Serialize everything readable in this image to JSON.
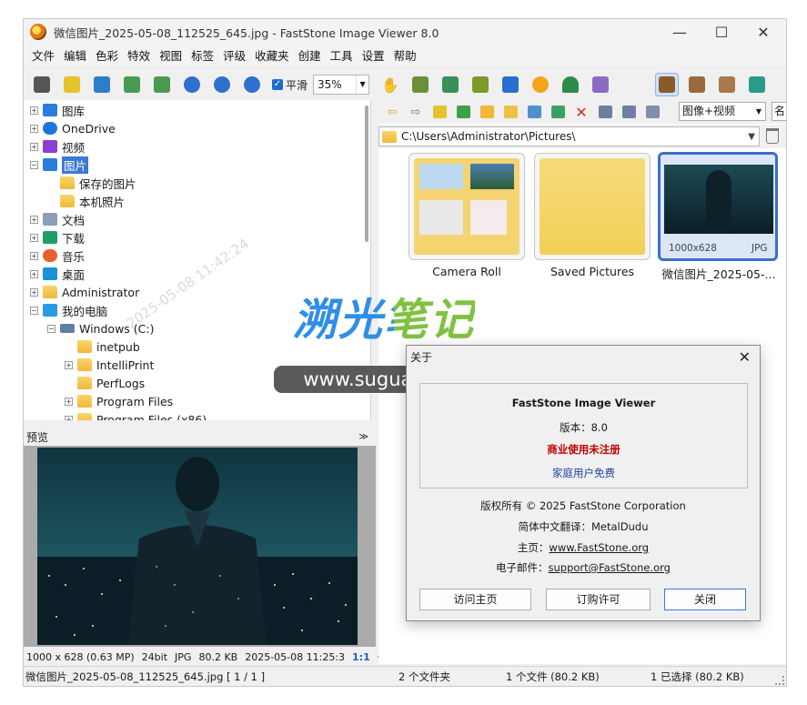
{
  "window": {
    "title": "微信图片_2025-05-08_112525_645.jpg  -  FastStone Image Viewer 8.0",
    "controls": {
      "minimize": "—",
      "maximize": "☐",
      "close": "✕"
    }
  },
  "menu": [
    "文件",
    "编辑",
    "色彩",
    "特效",
    "视图",
    "标签",
    "评级",
    "收藏夹",
    "创建",
    "工具",
    "设置",
    "帮助"
  ],
  "toolbar": {
    "smooth_label": "平滑",
    "zoom_value": "35%"
  },
  "tree": {
    "items": [
      {
        "label": "图库"
      },
      {
        "label": "OneDrive"
      },
      {
        "label": "视频"
      },
      {
        "label": "图片"
      },
      {
        "label": "保存的图片"
      },
      {
        "label": "本机照片"
      },
      {
        "label": "文档"
      },
      {
        "label": "下载"
      },
      {
        "label": "音乐"
      },
      {
        "label": "桌面"
      },
      {
        "label": "Administrator"
      },
      {
        "label": "我的电脑"
      },
      {
        "label": "Windows (C:)"
      },
      {
        "label": "inetpub"
      },
      {
        "label": "IntelliPrint"
      },
      {
        "label": "PerfLogs"
      },
      {
        "label": "Program Files"
      },
      {
        "label": "Program Files (x86)"
      }
    ],
    "faint_overlay_text": "2025-05-08 11:42:24"
  },
  "preview": {
    "heading": "预览",
    "info": {
      "dimensions": "1000 x 628 (0.63 MP)",
      "bit_depth": "24bit",
      "format": "JPG",
      "size": "80.2 KB",
      "datetime": "2025-05-08 11:25:3",
      "ratio": "1:1"
    }
  },
  "browser": {
    "filter_value": "图像+视频",
    "sort_value": "名",
    "path": "C:\\Users\\Administrator\\Pictures\\",
    "thumbnails": [
      {
        "label": "Camera Roll"
      },
      {
        "label": "Saved Pictures"
      },
      {
        "label": "微信图片_2025-05-...",
        "dims": "1000x628",
        "ext": "JPG"
      }
    ]
  },
  "watermark": {
    "logo_text": "溯光笔记",
    "url_text": "www.suguang999.cn"
  },
  "status": {
    "file": "微信图片_2025-05-08_112525_645.jpg [ 1 / 1 ]",
    "folders": "2 个文件夹",
    "files": "1 个文件 (80.2 KB)",
    "selected": "1 已选择 (80.2 KB)"
  },
  "about_dialog": {
    "title": "关于",
    "product": "FastStone Image Viewer",
    "version": "版本：8.0",
    "unregistered": "商业使用未注册",
    "free_home": "家庭用户免费",
    "copyright": "版权所有 © 2025 FastStone Corporation",
    "translator": "简体中文翻译：MetalDudu",
    "homepage_label": "主页：",
    "homepage": "www.FastStone.org",
    "email_label": "电子邮件：",
    "email": "support@FastStone.org",
    "buttons": {
      "visit": "访问主页",
      "order": "订购许可",
      "close": "关闭"
    }
  },
  "colors": {
    "selection_blue": "#3c79d6",
    "unregistered_red": "#c00000",
    "link_blue": "#1f3fa0"
  }
}
